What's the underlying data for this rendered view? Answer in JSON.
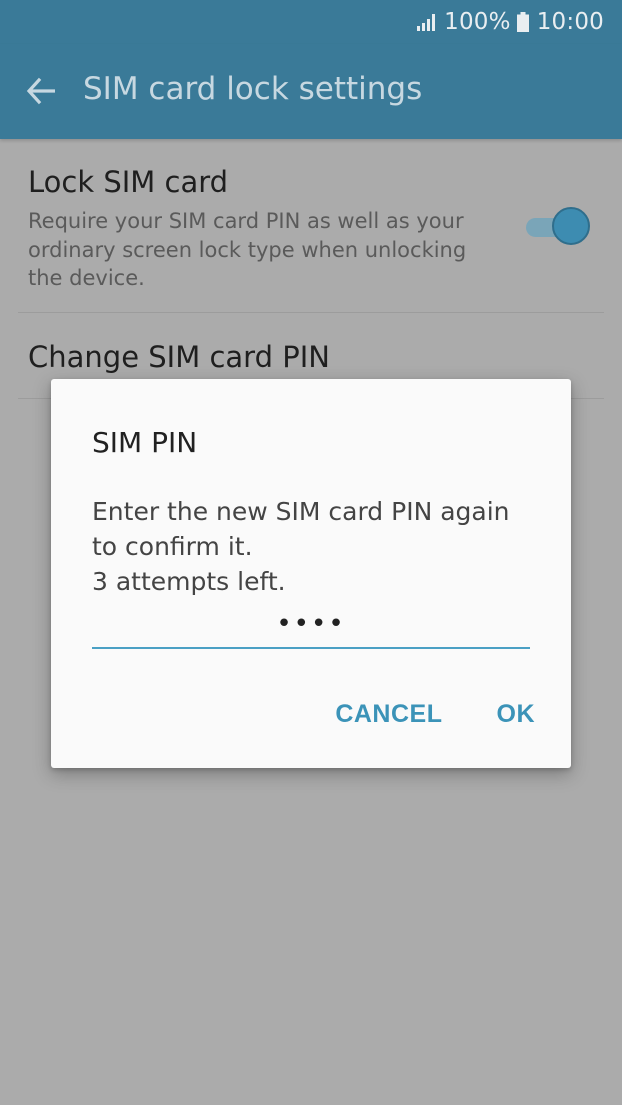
{
  "status_bar": {
    "battery": "100%",
    "time": "10:00",
    "icons": [
      "signal-icon",
      "battery-icon"
    ],
    "icon_color": "#e9eef1"
  },
  "app_bar": {
    "title": "SIM card lock settings",
    "back_icon": "back-arrow-icon",
    "background": "#3a7a98"
  },
  "settings": {
    "lock_sim": {
      "title": "Lock SIM card",
      "description": "Require your SIM card PIN as well as your ordinary screen lock type when unlocking the device.",
      "toggle_on": true
    },
    "change_pin": {
      "title": "Change SIM card PIN"
    }
  },
  "dialog": {
    "title": "SIM PIN",
    "message_line1": "Enter the new SIM card PIN again",
    "message_line2": "to confirm it.",
    "message_line3": "3 attempts left.",
    "pin_value": "••••",
    "cancel_label": "CANCEL",
    "ok_label": "OK",
    "accent": "#3b93b8"
  }
}
